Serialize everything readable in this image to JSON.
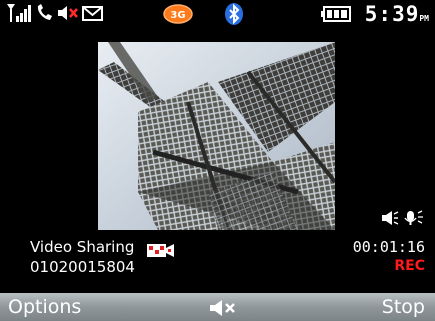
{
  "status_bar": {
    "time": "5:39",
    "ampm": "PM",
    "icons": [
      "signal-icon",
      "call-icon",
      "mute-icon",
      "message-icon",
      "3g-icon",
      "bluetooth-icon",
      "battery-icon"
    ]
  },
  "call": {
    "title": "Video Sharing",
    "number": "01020015804",
    "elapsed": "00:01:16",
    "rec_label": "REC"
  },
  "softkeys": {
    "left": "Options",
    "right": "Stop",
    "center_icon": "speaker-mute-icon"
  },
  "colors": {
    "rec": "#ff1a1a",
    "softbar": "#8f979b"
  }
}
